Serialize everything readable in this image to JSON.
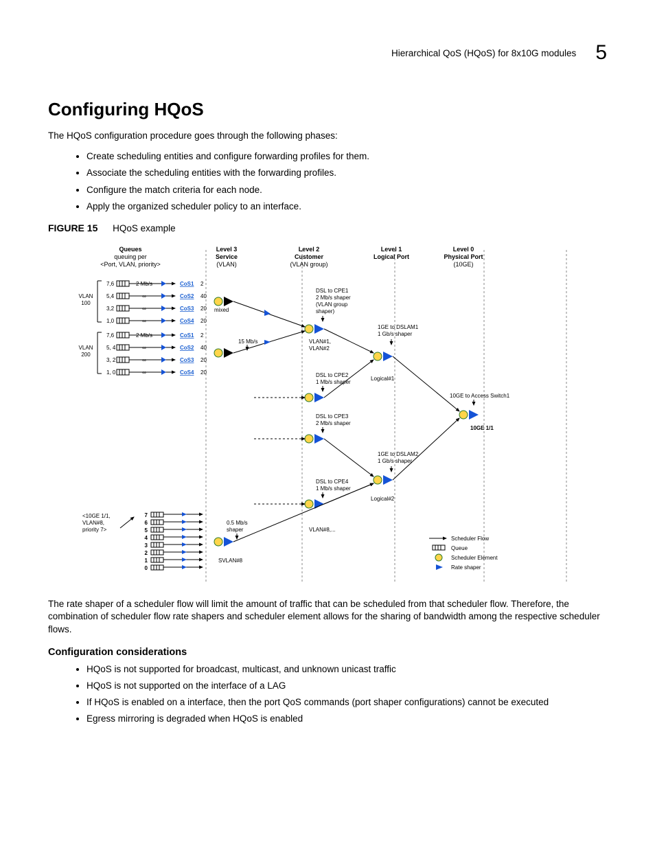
{
  "header": {
    "title": "Hierarchical QoS (HQoS) for 8x10G modules",
    "chapter": "5"
  },
  "h1": "Configuring HQoS",
  "intro": "The HQoS configuration procedure goes through the following phases:",
  "phases": [
    "Create scheduling entities and configure forwarding profiles for them.",
    "Associate the scheduling entities with the forwarding profiles.",
    "Configure the match criteria for each node.",
    "Apply the organized scheduler policy to an interface."
  ],
  "figure": {
    "label": "FIGURE 15",
    "title": "HQoS example"
  },
  "diagram": {
    "columns": [
      {
        "head": "Queues",
        "sub1": "queuing per",
        "sub2": "<Port, VLAN, priority>"
      },
      {
        "head": "Level 3",
        "sub1": "Service",
        "sub2": "(VLAN)"
      },
      {
        "head": "Level 2",
        "sub1": "Customer",
        "sub2": "(VLAN group)"
      },
      {
        "head": "Level 1",
        "sub1": "Logical Port",
        "sub2": ""
      },
      {
        "head": "Level 0",
        "sub1": "Physical Port",
        "sub2": "(10GE)"
      }
    ],
    "vlan100": {
      "label": "VLAN\n100",
      "rows": [
        {
          "pri": "7,6",
          "rate": "2 Mb/s",
          "cos": "CoS1",
          "w": "2"
        },
        {
          "pri": "5,4",
          "rate": "∞",
          "cos": "CoS2",
          "w": "40"
        },
        {
          "pri": "3,2",
          "rate": "∞",
          "cos": "CoS3",
          "w": "20"
        },
        {
          "pri": "1,0",
          "rate": "∞",
          "cos": "CoS4",
          "w": "20"
        }
      ],
      "mixed": "mixed"
    },
    "vlan200": {
      "label": "VLAN\n200",
      "rows": [
        {
          "pri": "7,6",
          "rate": "2 Mb/s",
          "cos": "CoS1",
          "w": "2"
        },
        {
          "pri": "5, 4",
          "rate": "∞",
          "cos": "CoS2",
          "w": "40"
        },
        {
          "pri": "3, 2",
          "rate": "∞",
          "cos": "CoS3",
          "w": "20"
        },
        {
          "pri": "1, 0",
          "rate": "∞",
          "cos": "CoS4",
          "w": "20"
        }
      ],
      "shaper": "15 Mb/s"
    },
    "level2": {
      "cpe1": "DSL to CPE1\n2 Mb/s shaper\n(VLAN group\nshaper)",
      "vlans12": "VLAN#1,\nVLAN#2",
      "cpe2": "DSL to CPE2\n1 Mb/s shaper",
      "cpe3": "DSL to CPE3\n2 Mb/s shaper",
      "cpe4": "DSL to CPE4\n1 Mb/s shaper",
      "vlan8": "VLAN#8,..."
    },
    "level1": {
      "dslam1": "1GE to DSLAM1\n1 Gb/s shaper",
      "log1": "Logical#1",
      "dslam2": "1GE to DSLAM2\n1 Gb/s shaper",
      "log2": "Logical#2"
    },
    "level0": {
      "access": "10GE to Access Switch1",
      "port": "10GE 1/1"
    },
    "bottom": {
      "tuple": "<10GE 1/1,\nVLAN#8,\npriority 7>",
      "pris": [
        "7",
        "6",
        "5",
        "4",
        "3",
        "2",
        "1",
        "0"
      ],
      "shaper": "0.5 Mb/s\nshaper",
      "svlan": "SVLAN#8"
    },
    "legend": {
      "flow": "Scheduler Flow",
      "queue": "Queue",
      "elem": "Scheduler Element",
      "rate": "Rate shaper"
    }
  },
  "after_text": "The rate shaper of a scheduler flow will limit the amount of traffic that can be scheduled from that scheduler flow. Therefore, the combination of scheduler flow rate shapers and scheduler element allows for the sharing of bandwidth among the respective scheduler flows.",
  "config_head": "Configuration considerations",
  "considerations": [
    "HQoS is not supported for broadcast, multicast, and unknown unicast traffic",
    "HQoS is not supported on the interface of a LAG",
    "If HQoS is enabled on a interface, then the port QoS commands (port shaper configurations) cannot be executed",
    "Egress mirroring is degraded when HQoS is enabled"
  ]
}
